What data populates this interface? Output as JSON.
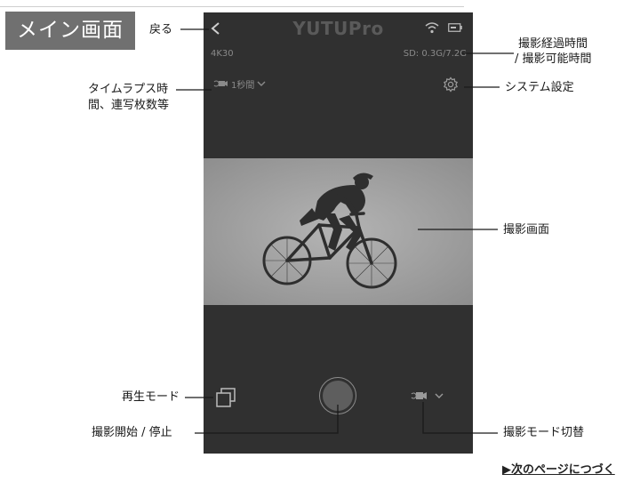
{
  "page": {
    "title": "メイン画面",
    "next_link": "▶次のページにつづく"
  },
  "app": {
    "title": "YUTUPro",
    "resolution": "4K30",
    "sd_status": "SD: 0.3G/7.2G",
    "timelapse_value": "1秒間"
  },
  "callouts": {
    "back": "戻る",
    "elapsed_1": "撮影経過時間",
    "elapsed_2": "/ 撮影可能時間",
    "interval_1": "タイムラプス時",
    "interval_2": "間、連写枚数等",
    "settings": "システム設定",
    "preview": "撮影画面",
    "playback": "再生モード",
    "shutter": "撮影開始 / 停止",
    "mode": "撮影モード切替"
  },
  "icons": [
    "back-icon",
    "wifi-icon",
    "battery-icon",
    "gear-icon",
    "timelapse-camera-icon",
    "gallery-icon",
    "camera-mode-icon",
    "chevron-down-icon"
  ],
  "colors": {
    "phone_bg": "#303030",
    "viewfinder_bg": "#9a9a9a",
    "badge_bg": "#707070"
  }
}
